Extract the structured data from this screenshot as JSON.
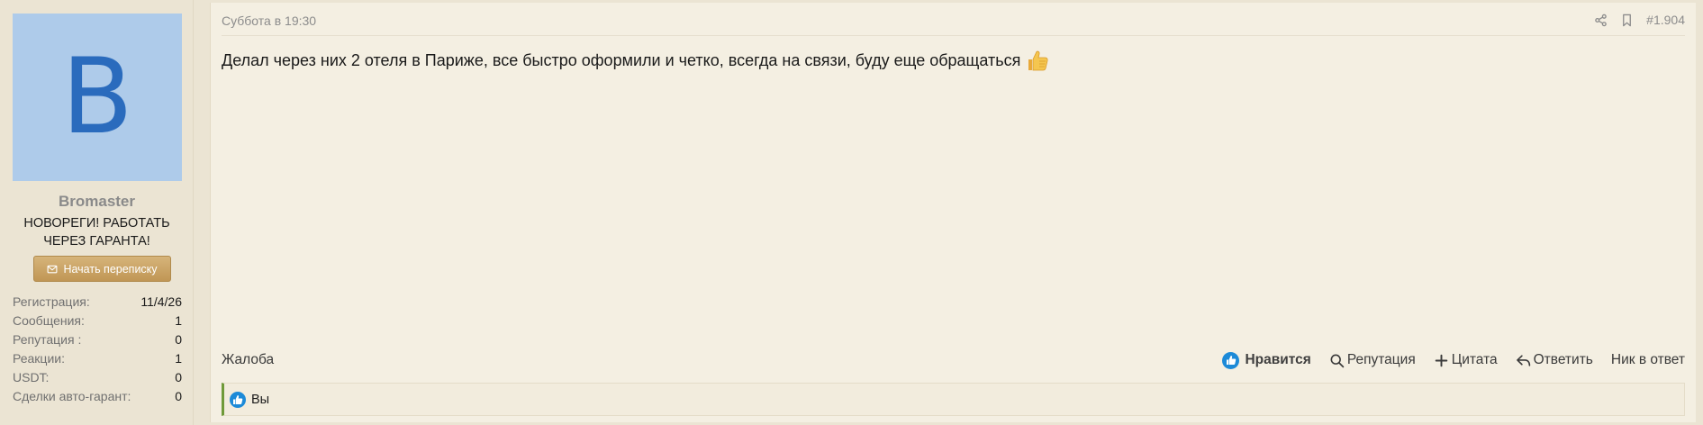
{
  "user": {
    "avatar_letter": "B",
    "avatar_bg": "#aecbea",
    "avatar_fg": "#2a6bbd",
    "name": "Bromaster",
    "title": "НОВОРЕГИ! РАБОТАТЬ ЧЕРЕЗ ГАРАНТА!",
    "message_button": "Начать переписку",
    "stats": [
      {
        "label": "Регистрация:",
        "value": "11/4/26"
      },
      {
        "label": "Сообщения:",
        "value": "1"
      },
      {
        "label": "Репутация :",
        "value": "0"
      },
      {
        "label": "Реакции:",
        "value": "1"
      },
      {
        "label": "USDT:",
        "value": "0"
      },
      {
        "label": "Сделки авто-гарант:",
        "value": "0"
      }
    ]
  },
  "post": {
    "date": "Суббота в 19:30",
    "number": "#1.904",
    "text": "Делал через них 2 отеля в Париже, все быстро оформили и четко, всегда на связи, буду еще обращаться",
    "emoji": "thumbs-up",
    "report": "Жалоба",
    "actions": {
      "like": "Нравится",
      "reputation": "Репутация",
      "quote": "Цитата",
      "reply": "Ответить",
      "nick_reply": "Ник в ответ"
    },
    "reactions_text": "Вы"
  },
  "colors": {
    "accent": "#c09655",
    "like_blue": "#1c8ad8",
    "reaction_bar": "#6f9a3a"
  }
}
